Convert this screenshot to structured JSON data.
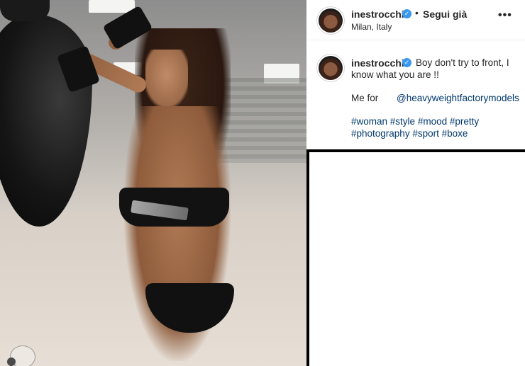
{
  "post": {
    "username": "inestrocchia",
    "verified_mark": "✓",
    "separator": "•",
    "follow_label": "Segui già",
    "location": "Milan, Italy",
    "more_label": "•••"
  },
  "caption": {
    "username": "inestrocchia",
    "line1": "Boy don't try to front, I",
    "line2": "know what you are !!",
    "line3": "Me for",
    "mention": "@heavyweightfactorymodels",
    "tags_line1": [
      "#woman",
      "#style",
      "#mood",
      "#pretty"
    ],
    "tags_line2": [
      "#photography",
      "#sport",
      "#boxe"
    ]
  },
  "colors": {
    "link": "#00376b",
    "verified": "#3897f0",
    "text": "#262626"
  },
  "icons": {
    "verified": "verified-badge-icon",
    "more": "more-options-icon"
  }
}
